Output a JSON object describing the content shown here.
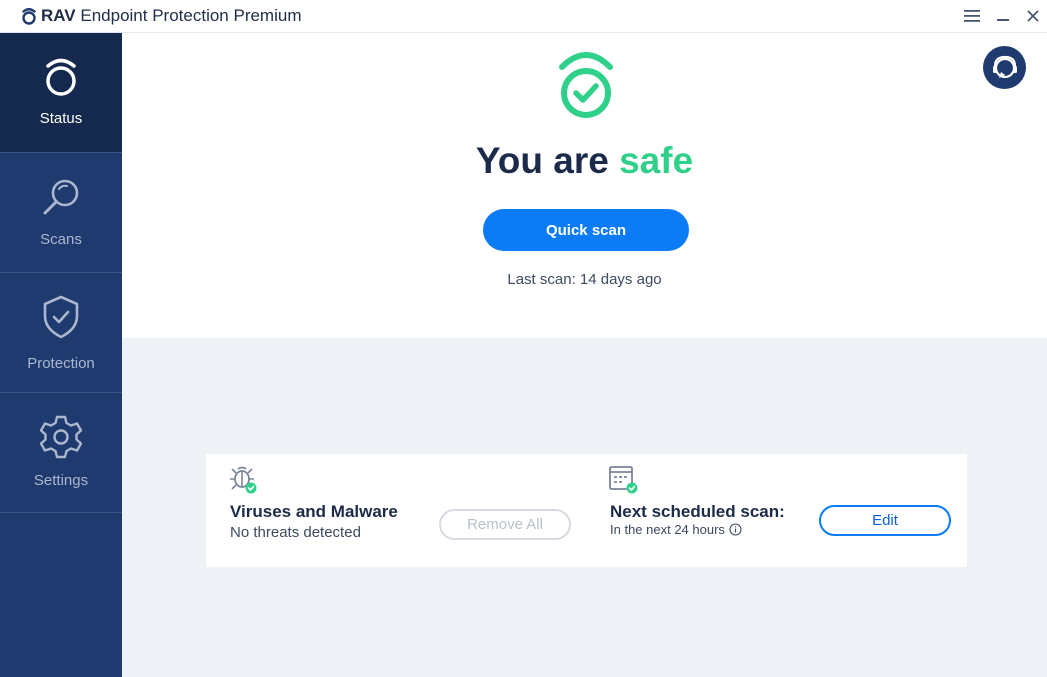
{
  "app": {
    "brand": "RAV",
    "product": "Endpoint Protection Premium"
  },
  "window_controls": {
    "menu_icon": "hamburger-icon",
    "minimize_icon": "minimize-icon",
    "close_icon": "close-icon"
  },
  "sidebar": {
    "items": [
      {
        "label": "Status",
        "icon": "rav-logo-icon",
        "active": true
      },
      {
        "label": "Scans",
        "icon": "magnifier-icon",
        "active": false
      },
      {
        "label": "Protection",
        "icon": "shield-check-icon",
        "active": false
      },
      {
        "label": "Settings",
        "icon": "gear-icon",
        "active": false
      }
    ]
  },
  "status": {
    "headline_prefix": "You are",
    "headline_state": "safe",
    "quick_scan_label": "Quick scan",
    "last_scan": "Last scan: 14 days ago",
    "support_icon": "headset-support-icon"
  },
  "cards": {
    "viruses": {
      "title": "Viruses and Malware",
      "subtitle": "No threats detected",
      "action_label": "Remove All",
      "action_enabled": false,
      "icon": "bug-check-icon"
    },
    "schedule": {
      "title": "Next scheduled scan:",
      "subtitle": "In the next 24 hours",
      "info_icon": "info-icon",
      "action_label": "Edit",
      "icon": "calendar-check-icon"
    }
  },
  "colors": {
    "sidebar": "#1f3a6e",
    "sidebar_active": "#15294f",
    "accent_blue": "#0b7cf5",
    "safe_green": "#2fd18a",
    "text_dark": "#1c2b4a"
  }
}
